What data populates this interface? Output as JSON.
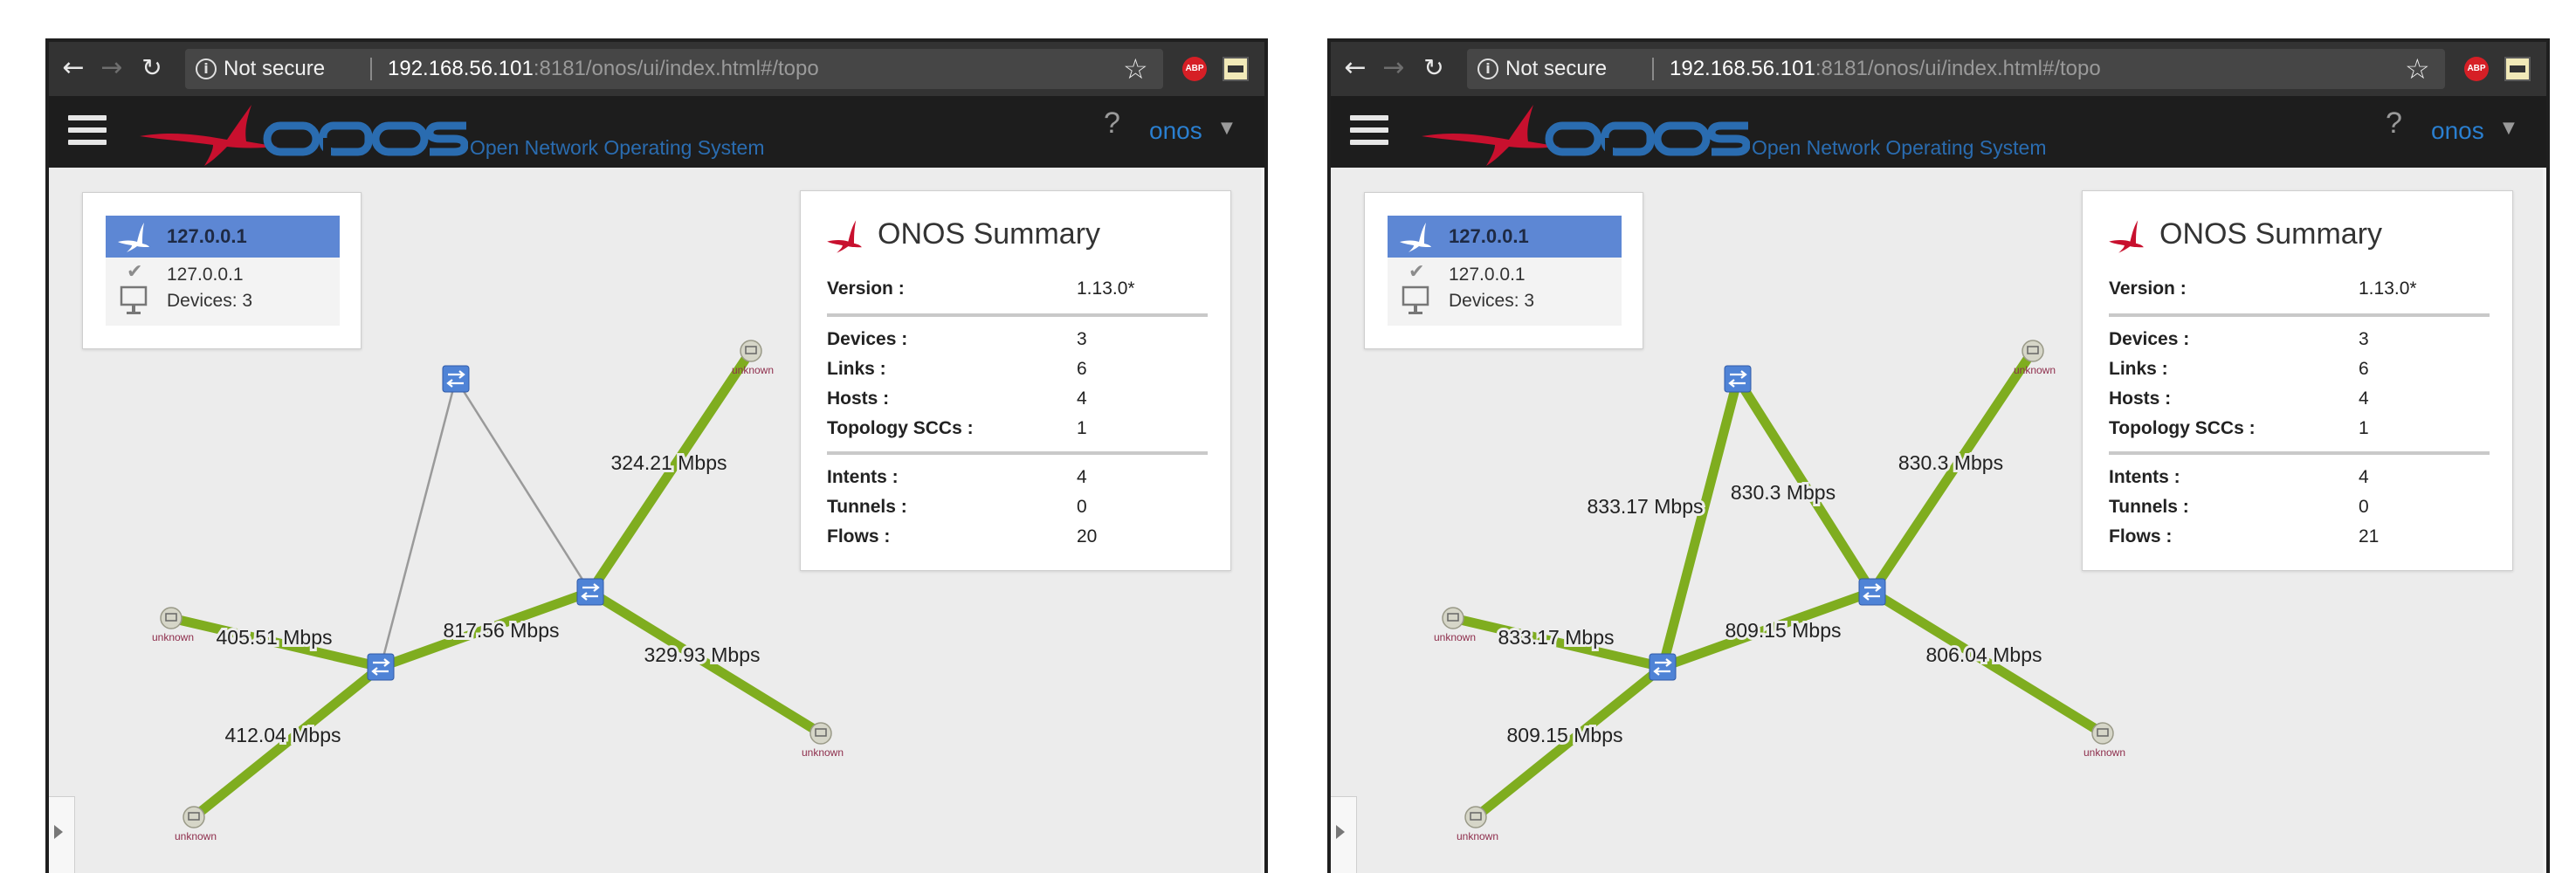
{
  "browser": {
    "not_secure_label": "Not secure",
    "url_host": "192.168.56.101",
    "url_path": ":8181/onos/ui/index.html#/topo",
    "icons": [
      "back-icon",
      "forward-icon",
      "reload-icon",
      "info-icon",
      "star-icon",
      "adblock-icon",
      "extension-icon",
      "kebab-menu-icon"
    ],
    "abp_label": "ABP"
  },
  "app": {
    "tagline": "Open Network Operating System",
    "help_label": "?",
    "user_label": "onos",
    "colors": {
      "brand_red": "#c8102e",
      "brand_blue": "#2a6cb0",
      "link_green": "#7fad1f",
      "switch_blue": "#4f83d6"
    }
  },
  "screens": [
    {
      "instance": {
        "title": "127.0.0.1",
        "ip": "127.0.0.1",
        "devices": "Devices: 3"
      },
      "summary": {
        "title": "ONOS Summary",
        "groups": [
          [
            {
              "label": "Version :",
              "value": "1.13.0*"
            }
          ],
          [
            {
              "label": "Devices :",
              "value": "3"
            },
            {
              "label": "Links :",
              "value": "6"
            },
            {
              "label": "Hosts :",
              "value": "4"
            },
            {
              "label": "Topology SCCs :",
              "value": "1"
            }
          ],
          [
            {
              "label": "Intents :",
              "value": "4"
            },
            {
              "label": "Tunnels :",
              "value": "0"
            },
            {
              "label": "Flows :",
              "value": "20"
            }
          ]
        ]
      },
      "topology": {
        "host_label": "unknown",
        "links": [
          {
            "label": "324.21 Mbps",
            "highlighted": true
          },
          {
            "label": "817.56 Mbps",
            "highlighted": true
          },
          {
            "label": "329.93 Mbps",
            "highlighted": true
          },
          {
            "label": "405.51 Mbps",
            "highlighted": true
          },
          {
            "label": "412.04 Mbps",
            "highlighted": true
          },
          {
            "label": "",
            "highlighted": false
          },
          {
            "label": "",
            "highlighted": false
          }
        ]
      }
    },
    {
      "instance": {
        "title": "127.0.0.1",
        "ip": "127.0.0.1",
        "devices": "Devices: 3"
      },
      "summary": {
        "title": "ONOS Summary",
        "groups": [
          [
            {
              "label": "Version :",
              "value": "1.13.0*"
            }
          ],
          [
            {
              "label": "Devices :",
              "value": "3"
            },
            {
              "label": "Links :",
              "value": "6"
            },
            {
              "label": "Hosts :",
              "value": "4"
            },
            {
              "label": "Topology SCCs :",
              "value": "1"
            }
          ],
          [
            {
              "label": "Intents :",
              "value": "4"
            },
            {
              "label": "Tunnels :",
              "value": "0"
            },
            {
              "label": "Flows :",
              "value": "21"
            }
          ]
        ]
      },
      "topology": {
        "host_label": "unknown",
        "links": [
          {
            "label": "830.3 Mbps",
            "highlighted": true
          },
          {
            "label": "809.15 Mbps",
            "highlighted": true
          },
          {
            "label": "806.04 Mbps",
            "highlighted": true
          },
          {
            "label": "833.17 Mbps",
            "highlighted": true
          },
          {
            "label": "809.15 Mbps",
            "highlighted": true
          },
          {
            "label": "833.17 Mbps",
            "highlighted": true
          },
          {
            "label": "830.3 Mbps",
            "highlighted": true
          }
        ]
      }
    }
  ]
}
